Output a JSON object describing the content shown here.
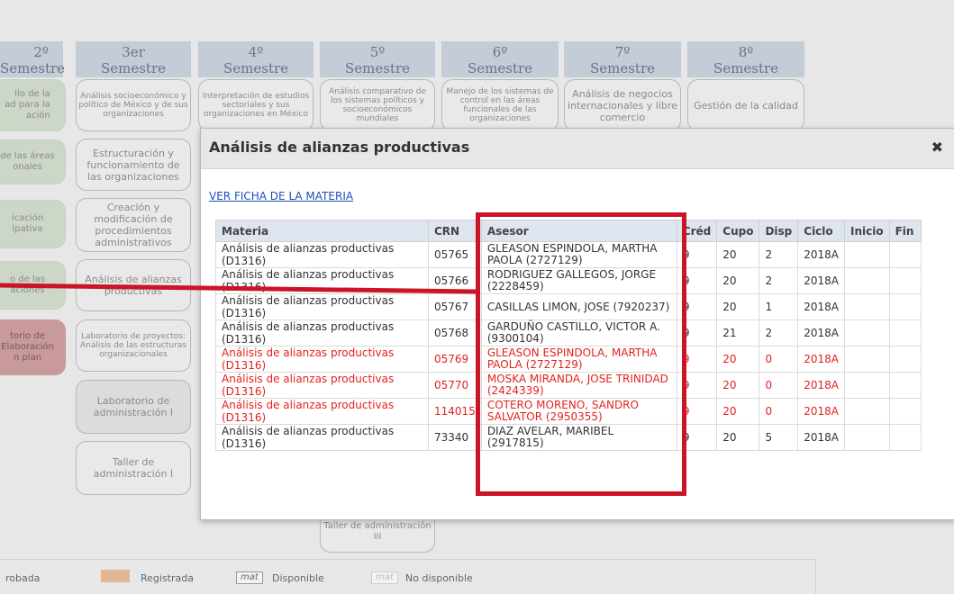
{
  "semesters": [
    {
      "num": "2º",
      "label": "Semestre"
    },
    {
      "num": "3er",
      "label": "Semestre"
    },
    {
      "num": "4º",
      "label": "Semestre"
    },
    {
      "num": "5º",
      "label": "Semestre"
    },
    {
      "num": "6º",
      "label": "Semestre"
    },
    {
      "num": "7º",
      "label": "Semestre"
    },
    {
      "num": "8º",
      "label": "Semestre"
    }
  ],
  "courses": {
    "c2a": "llo de la\nad para la\nación",
    "c2b": "de las áreas\nonales",
    "c2c": "icación\nipativa",
    "c2d": "o de las\naciones",
    "c2e": "torio de\nElaboración\nn plan",
    "c3a": "Análisis socioeconómico y político de México y de sus organizaciones",
    "c3b": "Estructuración y funcionamiento de las organizaciones",
    "c3c": "Creación y modificación de procedimientos administrativos",
    "c3d": "Análisis de alianzas productivas",
    "c3e": "Laboratorio de proyectos: Análisis de las estructuras organizacionales",
    "c3f": "Laboratorio de administración I",
    "c3g": "Taller de administración I",
    "c4a": "Interpretación de estudios sectoriales y sus organizaciones en México",
    "c5a": "Análisis comparativo de los sistemas políticos y socioeconómicos mundiales",
    "c5b": "Taller de administración III",
    "c6a": "Manejo de los sistemas de control en las áreas funcionales de las organizaciones",
    "c7a": "Análisis de negocios internacionales y libre comercio",
    "c8a": "Gestión de la calidad"
  },
  "legend": {
    "aprobada": "robada",
    "registrada": "Registrada",
    "mat": "mat",
    "disponible": "Disponible",
    "no_disponible": "No disponible"
  },
  "modal": {
    "title": "Análisis de alianzas productivas",
    "close": "✖",
    "ficha_link": "VER FICHA DE LA MATERIA",
    "headers": [
      "Materia",
      "CRN",
      "Asesor",
      "Créd",
      "Cupo",
      "Disp",
      "Ciclo",
      "Inicio",
      "Fin"
    ],
    "rows": [
      {
        "materia": "Análisis de alianzas productivas (D1316)",
        "crn": "05765",
        "asesor": "GLEASON ESPINDOLA, MARTHA PAOLA (2727129)",
        "cred": "9",
        "cupo": "20",
        "disp": "2",
        "ciclo": "2018A",
        "inicio": "",
        "fin": "",
        "status": "available"
      },
      {
        "materia": "Análisis de alianzas productivas (D1316)",
        "crn": "05766",
        "asesor": "RODRIGUEZ GALLEGOS, JORGE (2228459)",
        "cred": "9",
        "cupo": "20",
        "disp": "2",
        "ciclo": "2018A",
        "inicio": "",
        "fin": "",
        "status": "available"
      },
      {
        "materia": "Análisis de alianzas productivas (D1316)",
        "crn": "05767",
        "asesor": "CASILLAS LIMON, JOSE (7920237)",
        "cred": "9",
        "cupo": "20",
        "disp": "1",
        "ciclo": "2018A",
        "inicio": "",
        "fin": "",
        "status": "available"
      },
      {
        "materia": "Análisis de alianzas productivas (D1316)",
        "crn": "05768",
        "asesor": "GARDUÑO CASTILLO, VICTOR A. (9300104)",
        "cred": "9",
        "cupo": "21",
        "disp": "2",
        "ciclo": "2018A",
        "inicio": "",
        "fin": "",
        "status": "available"
      },
      {
        "materia": "Análisis de alianzas productivas (D1316)",
        "crn": "05769",
        "asesor": "GLEASON ESPINDOLA, MARTHA PAOLA (2727129)",
        "cred": "9",
        "cupo": "20",
        "disp": "0",
        "ciclo": "2018A",
        "inicio": "",
        "fin": "",
        "status": "full"
      },
      {
        "materia": "Análisis de alianzas productivas (D1316)",
        "crn": "05770",
        "asesor": "MOSKA MIRANDA, JOSE TRINIDAD (2424339)",
        "cred": "9",
        "cupo": "20",
        "disp": "0",
        "ciclo": "2018A",
        "inicio": "",
        "fin": "",
        "status": "full"
      },
      {
        "materia": "Análisis de alianzas productivas (D1316)",
        "crn": "114015",
        "asesor": "COTERO MORENO, SANDRO SALVATOR (2950355)",
        "cred": "9",
        "cupo": "20",
        "disp": "0",
        "ciclo": "2018A",
        "inicio": "",
        "fin": "",
        "status": "full"
      },
      {
        "materia": "Análisis de alianzas productivas (D1316)",
        "crn": "73340",
        "asesor": "DIAZ AVELAR, MARIBEL (2917815)",
        "cred": "9",
        "cupo": "20",
        "disp": "5",
        "ciclo": "2018A",
        "inicio": "",
        "fin": "",
        "status": "available"
      }
    ]
  },
  "colors": {
    "highlight": "#cc1427",
    "full_row_text": "#e0231e",
    "header_bg": "#c4ccd8",
    "registrada": "#e0b891"
  }
}
